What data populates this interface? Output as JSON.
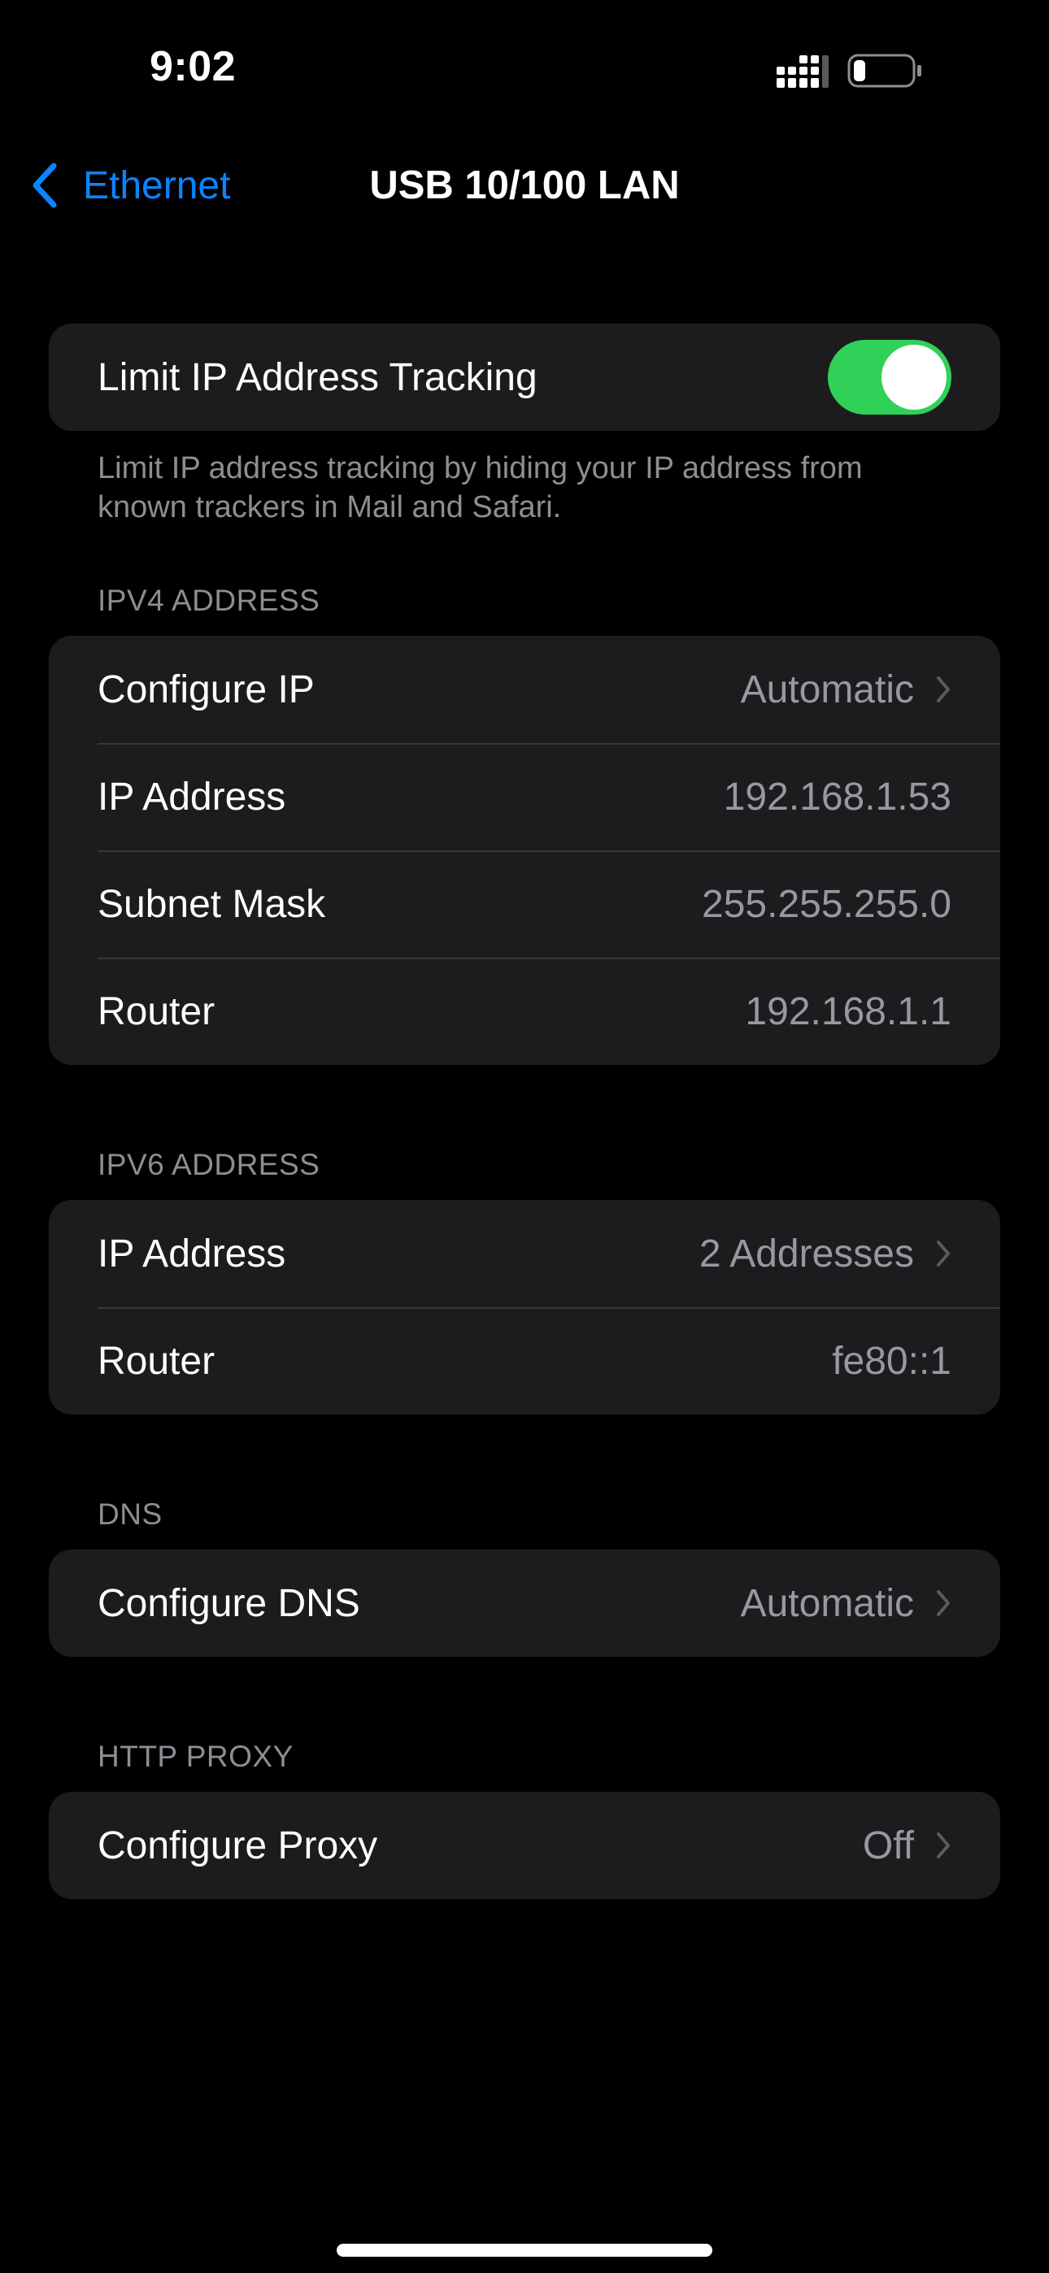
{
  "status_bar": {
    "time": "9:02",
    "signal_icon": "cellular-signal-icon",
    "battery_icon": "battery-low-icon"
  },
  "nav": {
    "back_label": "Ethernet",
    "title": "USB 10/100 LAN"
  },
  "tracking": {
    "label": "Limit IP Address Tracking",
    "enabled": true,
    "footer": "Limit IP address tracking by hiding your IP address from known trackers in Mail and Safari."
  },
  "ipv4": {
    "header": "IPV4 ADDRESS",
    "rows": [
      {
        "label": "Configure IP",
        "value": "Automatic",
        "chevron": true
      },
      {
        "label": "IP Address",
        "value": "192.168.1.53",
        "chevron": false
      },
      {
        "label": "Subnet Mask",
        "value": "255.255.255.0",
        "chevron": false
      },
      {
        "label": "Router",
        "value": "192.168.1.1",
        "chevron": false
      }
    ]
  },
  "ipv6": {
    "header": "IPV6 ADDRESS",
    "rows": [
      {
        "label": "IP Address",
        "value": "2 Addresses",
        "chevron": true
      },
      {
        "label": "Router",
        "value": "fe80::1",
        "chevron": false
      }
    ]
  },
  "dns": {
    "header": "DNS",
    "rows": [
      {
        "label": "Configure DNS",
        "value": "Automatic",
        "chevron": true
      }
    ]
  },
  "proxy": {
    "header": "HTTP PROXY",
    "rows": [
      {
        "label": "Configure Proxy",
        "value": "Off",
        "chevron": true
      }
    ]
  },
  "colors": {
    "accent": "#0a84ff",
    "toggle_on": "#30d158",
    "background": "#000000",
    "cell": "#1c1c1e",
    "secondary_text": "#98989f"
  }
}
